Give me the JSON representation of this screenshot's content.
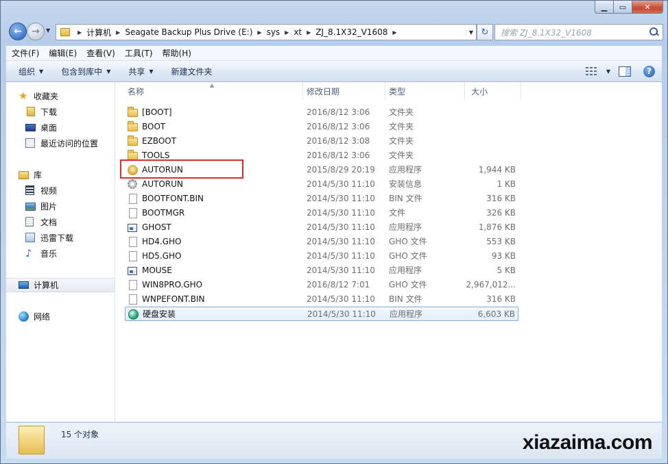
{
  "window": {
    "caption_min": "▁",
    "caption_max": "▭",
    "caption_close": "✕"
  },
  "address": {
    "crumbs": [
      "计算机",
      "Seagate Backup Plus Drive (E:)",
      "sys",
      "xt",
      "ZJ_8.1X32_V1608"
    ]
  },
  "search": {
    "placeholder": "搜索 ZJ_8.1X32_V1608"
  },
  "menubar": {
    "items": [
      "文件(F)",
      "编辑(E)",
      "查看(V)",
      "工具(T)",
      "帮助(H)"
    ]
  },
  "toolbar": {
    "organize": "组织",
    "include_library": "包含到库中",
    "share": "共享",
    "new_folder": "新建文件夹"
  },
  "navpane": {
    "favorites": "收藏夹",
    "downloads": "下载",
    "desktop": "桌面",
    "recent": "最近访问的位置",
    "libraries": "库",
    "videos": "视频",
    "pictures": "图片",
    "documents": "文档",
    "thunder": "迅雷下载",
    "music": "音乐",
    "computer": "计算机",
    "network": "网络"
  },
  "columns": {
    "name": "名称",
    "date": "修改日期",
    "type": "类型",
    "size": "大小"
  },
  "files": [
    {
      "name": "[BOOT]",
      "date": "2016/8/12 3:06",
      "type": "文件夹",
      "size": "",
      "icon": "folder-icon"
    },
    {
      "name": "BOOT",
      "date": "2016/8/12 3:06",
      "type": "文件夹",
      "size": "",
      "icon": "folder-icon"
    },
    {
      "name": "EZBOOT",
      "date": "2016/8/12 3:08",
      "type": "文件夹",
      "size": "",
      "icon": "folder-icon"
    },
    {
      "name": "TOOLS",
      "date": "2016/8/12 3:06",
      "type": "文件夹",
      "size": "",
      "icon": "folder-icon"
    },
    {
      "name": "AUTORUN",
      "date": "2015/8/29 20:19",
      "type": "应用程序",
      "size": "1,944 KB",
      "icon": "autorun-app-icon"
    },
    {
      "name": "AUTORUN",
      "date": "2014/5/30 11:10",
      "type": "安装信息",
      "size": "1 KB",
      "icon": "setup-info-icon"
    },
    {
      "name": "BOOTFONT.BIN",
      "date": "2014/5/30 11:10",
      "type": "BIN 文件",
      "size": "316 KB",
      "icon": "file-icon"
    },
    {
      "name": "BOOTMGR",
      "date": "2014/5/30 11:10",
      "type": "文件",
      "size": "326 KB",
      "icon": "file-icon"
    },
    {
      "name": "GHOST",
      "date": "2014/5/30 11:10",
      "type": "应用程序",
      "size": "1,876 KB",
      "icon": "app-window-icon"
    },
    {
      "name": "HD4.GHO",
      "date": "2014/5/30 11:10",
      "type": "GHO 文件",
      "size": "553 KB",
      "icon": "file-icon"
    },
    {
      "name": "HD5.GHO",
      "date": "2014/5/30 11:10",
      "type": "GHO 文件",
      "size": "93 KB",
      "icon": "file-icon"
    },
    {
      "name": "MOUSE",
      "date": "2014/5/30 11:10",
      "type": "应用程序",
      "size": "5 KB",
      "icon": "app-window-icon"
    },
    {
      "name": "WIN8PRO.GHO",
      "date": "2016/8/12 7:01",
      "type": "GHO 文件",
      "size": "2,967,012...",
      "icon": "file-icon"
    },
    {
      "name": "WNPEFONT.BIN",
      "date": "2014/5/30 11:10",
      "type": "BIN 文件",
      "size": "316 KB",
      "icon": "file-icon"
    },
    {
      "name": "硬盘安装",
      "date": "2014/5/30 11:10",
      "type": "应用程序",
      "size": "6,603 KB",
      "icon": "disk-installer-icon"
    }
  ],
  "details": {
    "count": "15 个对象"
  },
  "watermark": "xiazaima.com"
}
